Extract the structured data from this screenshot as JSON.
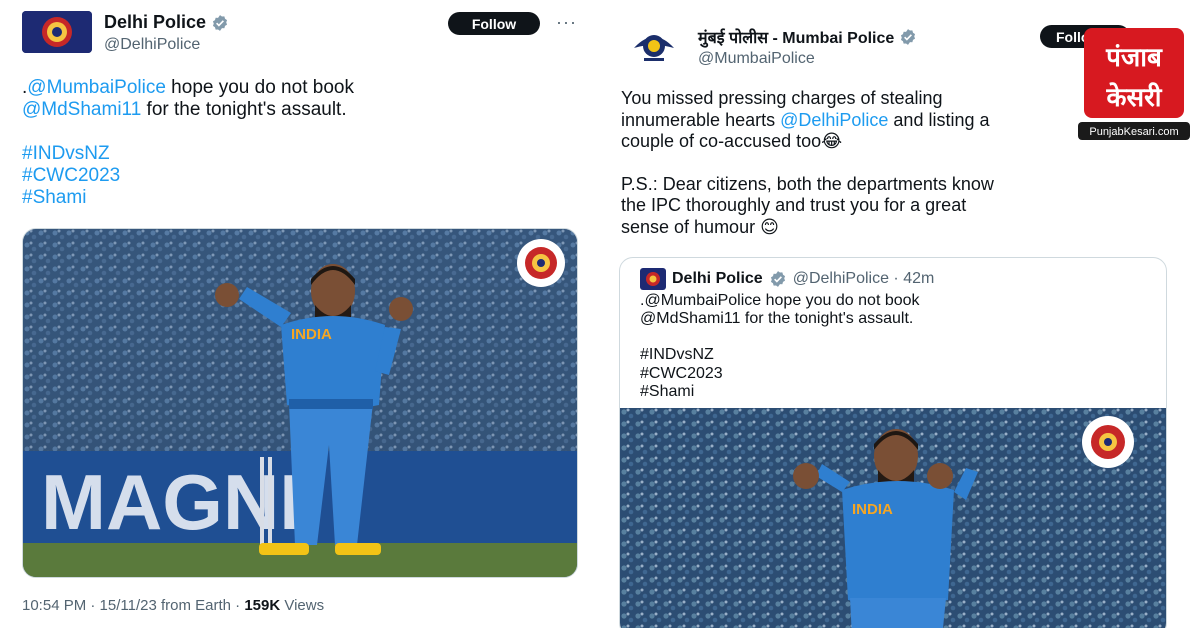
{
  "left_tweet": {
    "display_name": "Delhi Police",
    "handle": "@DelhiPolice",
    "follow_label": "Follow",
    "more_icon": "···",
    "text_prefix": ".",
    "mention_1": "@MumbaiPolice",
    "text_1": " hope you do not book",
    "mention_2": "@MdShami11",
    "text_2": " for the tonight's assault.",
    "hashtags": [
      "#INDvsNZ",
      "#CWC2023",
      "#Shami"
    ],
    "image_text": "MAGNI",
    "jersey_text": "INDIA",
    "meta_time": "10:54 PM · 15/11/23 from Earth · ",
    "meta_views_count": "159K",
    "meta_views_label": " Views"
  },
  "right_tweet": {
    "display_name": "मुंबई पोलीस - Mumbai Police",
    "handle": "@MumbaiPolice",
    "follow_label": "Follow",
    "text_line_1": "You missed pressing charges of stealing",
    "text_line_2_a": "innumerable hearts ",
    "text_line_2_mention": "@DelhiPolice",
    "text_line_2_b": " and listing a",
    "text_line_3": "couple of co-accused too😂",
    "text_line_4": "P.S.: Dear citizens, both the departments know",
    "text_line_5": "the IPC thoroughly and trust you for a great",
    "text_line_6": "sense of humour 😊",
    "quote": {
      "display_name": "Delhi Police",
      "handle_time": "@DelhiPolice · 42m",
      "line_1": ".@MumbaiPolice hope you do not book",
      "line_2": "@MdShami11 for the tonight's assault.",
      "hashtags": [
        "#INDvsNZ",
        "#CWC2023",
        "#Shami"
      ],
      "jersey_text": "INDIA"
    }
  },
  "watermark": {
    "line_1": "पंजाब",
    "line_2": "केसरी",
    "site": "PunjabKesari.com"
  },
  "colors": {
    "link": "#1d9bf0",
    "verified": "#829aab",
    "follow_bg": "#0f1419",
    "jersey": "#2f7fd0",
    "logo_red": "#d71920"
  }
}
